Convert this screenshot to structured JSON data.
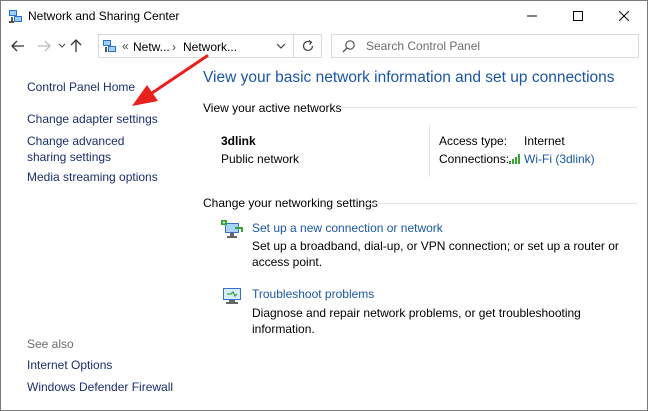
{
  "window": {
    "title": "Network and Sharing Center",
    "buttons": {
      "minimize": "minimize",
      "maximize": "maximize",
      "close": "close"
    }
  },
  "nav": {
    "breadcrumb_overflow": "«",
    "breadcrumb": [
      "Netw...",
      "Network..."
    ],
    "separator": "›",
    "search_placeholder": "Search Control Panel"
  },
  "sidebar": {
    "links": [
      "Control Panel Home",
      "Change adapter settings",
      "Change advanced sharing settings",
      "Media streaming options"
    ],
    "see_also_label": "See also",
    "see_also_links": [
      "Internet Options",
      "Windows Defender Firewall"
    ]
  },
  "main": {
    "title": "View your basic network information and set up connections",
    "active_header": "View your active networks",
    "network_name": "3dlink",
    "network_category": "Public network",
    "access_type_label": "Access type:",
    "access_type_value": "Internet",
    "connections_label": "Connections:",
    "connections_value": "Wi-Fi (3dlink)",
    "change_header": "Change your networking settings",
    "tasks": [
      {
        "icon": "new-connection-icon",
        "link": "Set up a new connection or network",
        "desc": "Set up a broadband, dial-up, or VPN connection; or set up a router or access point."
      },
      {
        "icon": "troubleshoot-icon",
        "link": "Troubleshoot problems",
        "desc": "Diagnose and repair network problems, or get troubleshooting information."
      }
    ]
  },
  "colors": {
    "link": "#1a57a6",
    "sidebar_link": "#1a2e6e",
    "annotation_arrow": "#e8201e",
    "signal": "#3aa537"
  }
}
